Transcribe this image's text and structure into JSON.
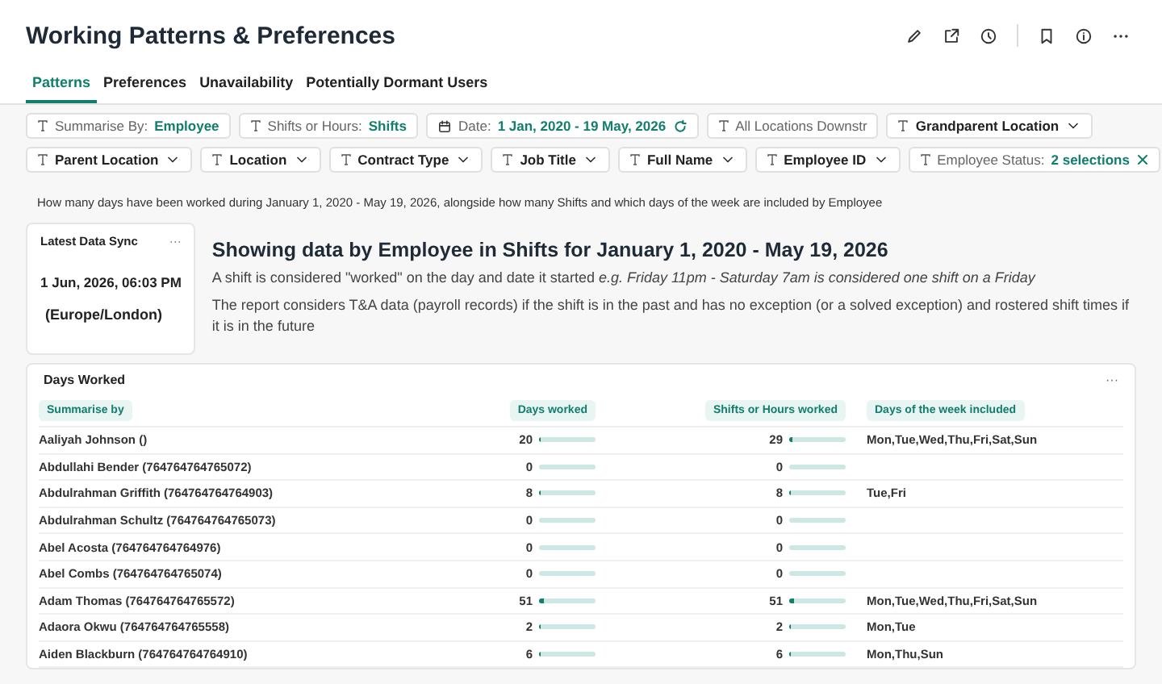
{
  "title": "Working Patterns & Preferences",
  "tabs": [
    {
      "label": "Patterns",
      "selected": true
    },
    {
      "label": "Preferences",
      "selected": false
    },
    {
      "label": "Unavailability",
      "selected": false
    },
    {
      "label": "Potentially Dormant Users",
      "selected": false
    }
  ],
  "filters": [
    [
      {
        "kind": "value",
        "label": "Summarise By:",
        "value": "Employee"
      },
      {
        "kind": "value",
        "label": "Shifts or Hours:",
        "value": "Shifts"
      },
      {
        "kind": "date",
        "label": "Date:",
        "value": "1 Jan, 2020 - 19 May, 2026"
      },
      {
        "kind": "text",
        "label": "All Locations Downstr"
      },
      {
        "kind": "dropdown",
        "label": "Grandparent Location"
      }
    ],
    [
      {
        "kind": "dropdown",
        "label": "Parent Location"
      },
      {
        "kind": "dropdown",
        "label": "Location"
      },
      {
        "kind": "dropdown",
        "label": "Contract Type"
      },
      {
        "kind": "dropdown",
        "label": "Job Title"
      },
      {
        "kind": "dropdown",
        "label": "Full Name"
      },
      {
        "kind": "dropdown",
        "label": "Employee ID"
      },
      {
        "kind": "clearable",
        "label": "Employee Status:",
        "value": "2 selections"
      }
    ]
  ],
  "description": "How many days have been worked during January 1, 2020 - May 19, 2026, alongside how many Shifts and which days of the week are included by Employee",
  "sync_card": {
    "title": "Latest Data Sync",
    "menu": "···",
    "datetime": "1 Jun, 2026, 06:03 PM",
    "timezone": "(Europe/London)"
  },
  "info": {
    "heading": "Showing data by Employee in Shifts for January 1, 2020 - May 19, 2026",
    "note": "A shift is considered \"worked\" on the day and date it started *e.g. Friday 11pm - Saturday 7am is considered one shift on a Friday*",
    "detail": "The report considers T&A data (payroll records) if the shift is in the past and has no exception (or a solved exception) and rostered shift times if it is in the future"
  },
  "table": {
    "title": "Days Worked",
    "menu": "···",
    "columns": [
      "Summarise by",
      "Days worked",
      "Shifts or Hours worked",
      "Days of the week included"
    ],
    "rows": [
      {
        "name": "Aaliyah Johnson ()",
        "days": "20",
        "days_bar": {
          "level": 0.03
        },
        "shifts": "29",
        "shifts_bar": {
          "level": 0.05
        },
        "weekdays": "Mon,Tue,Wed,Thu,Fri,Sat,Sun"
      },
      {
        "name": "Abdullahi Bender (764764764765072)",
        "days": "0",
        "shifts": "0"
      },
      {
        "name": "Abdulrahman Griffith (764764764764903)",
        "days": "8",
        "days_bar": {
          "level": 0.015
        },
        "shifts": "8",
        "shifts_bar": {
          "level": 0.015
        },
        "weekdays": "Tue,Fri"
      },
      {
        "name": "Abdulrahman Schultz (764764764765073)",
        "days": "0",
        "shifts": "0"
      },
      {
        "name": "Abel Acosta (764764764764976)",
        "days": "0",
        "shifts": "0"
      },
      {
        "name": "Abel Combs (764764764765074)",
        "days": "0",
        "shifts": "0"
      },
      {
        "name": "Adam Thomas (764764764765572)",
        "days": "51",
        "days_bar": {
          "level": 0.08
        },
        "shifts": "51",
        "shifts_bar": {
          "level": 0.08
        },
        "weekdays": "Mon,Tue,Wed,Thu,Fri,Sat,Sun"
      },
      {
        "name": "Adaora Okwu (764764764765558)",
        "days": "2",
        "days_bar": {
          "level": 0.01
        },
        "shifts": "2",
        "shifts_bar": {
          "level": 0.01
        },
        "weekdays": "Mon,Tue"
      },
      {
        "name": "Aiden Blackburn (764764764764910)",
        "days": "6",
        "days_bar": {
          "level": 0.012
        },
        "shifts": "6",
        "shifts_bar": {
          "level": 0.012
        },
        "weekdays": "Mon,Thu,Sun"
      }
    ]
  }
}
